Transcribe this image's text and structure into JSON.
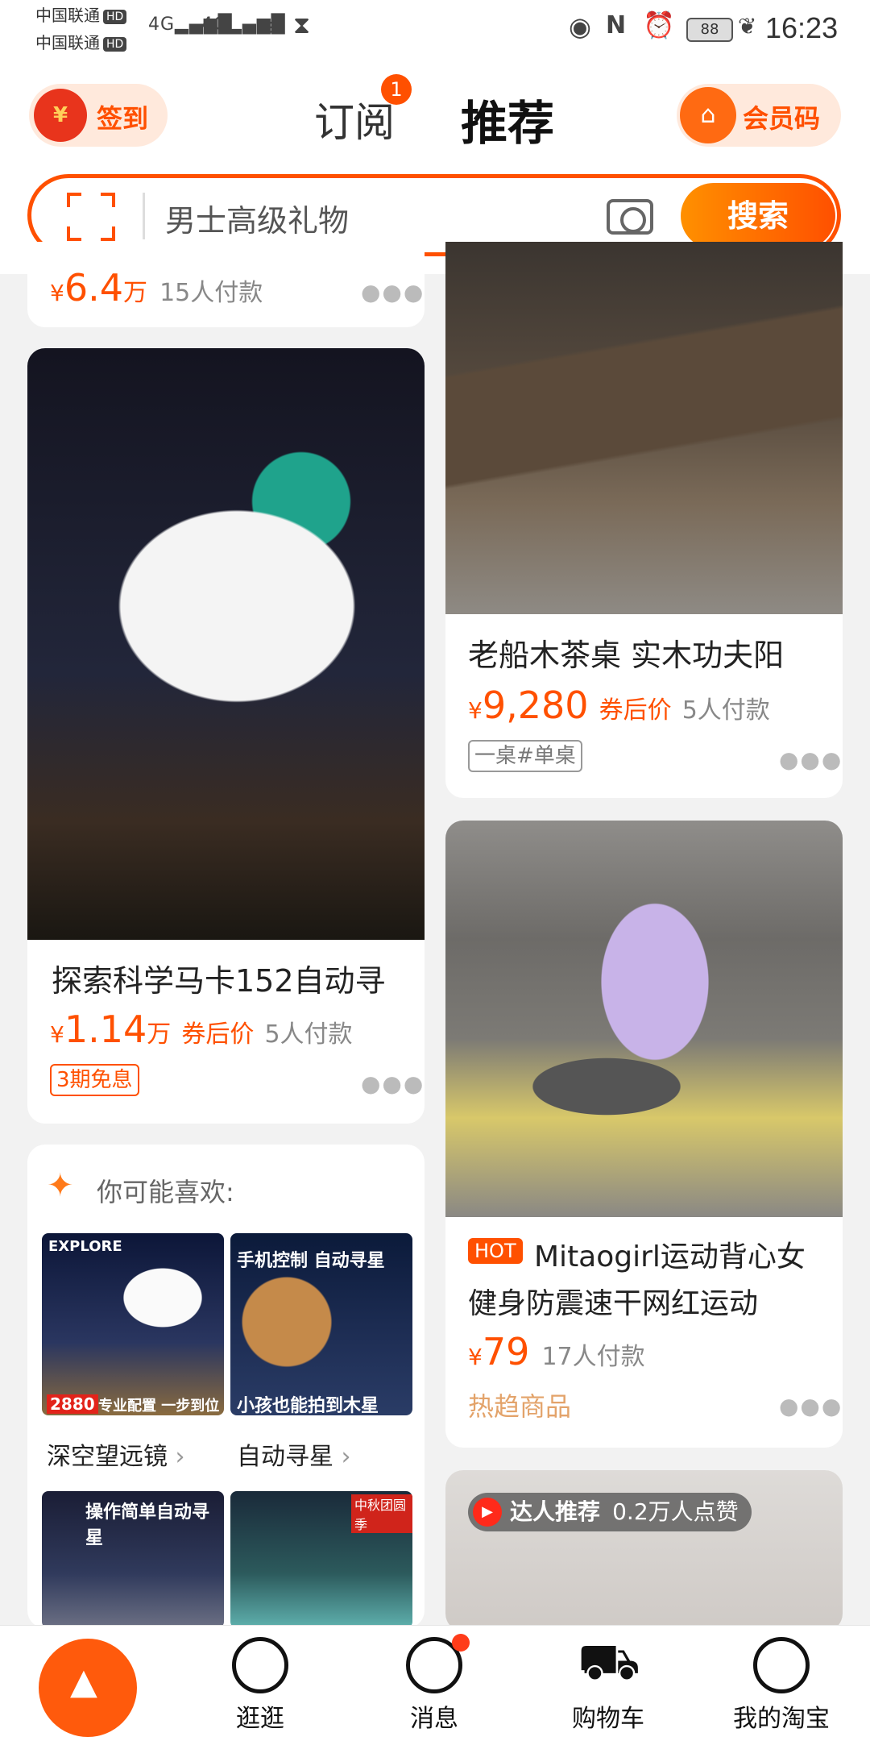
{
  "status_bar": {
    "carrier1": "中国联通",
    "carrier2": "中国联通",
    "hd_badge": "HD",
    "signal1": "4G",
    "signal2": "4G",
    "battery": "88",
    "time": "16:23"
  },
  "header": {
    "signin_label": "签到",
    "signin_icon_text": "¥",
    "tab_subscribe": "订阅",
    "tab_subscribe_badge": "1",
    "tab_recommend": "推荐",
    "member_label": "会员码"
  },
  "search": {
    "placeholder": "男士高级礼物",
    "button": "搜索"
  },
  "feed_left": {
    "top_card": {
      "price_symbol": "¥",
      "price": "6.4",
      "unit": "万",
      "paid": "15人付款"
    },
    "telescope_card": {
      "title": "探索科学马卡152自动寻",
      "price_symbol": "¥",
      "price": "1.14",
      "unit": "万",
      "coupon": "券后价",
      "paid": "5人付款",
      "tag": "3期免息"
    },
    "like_card": {
      "heading": "你可能喜欢:",
      "items": [
        {
          "caption": "",
          "category": "深空望远镜"
        },
        {
          "caption": "小孩也能拍到木星",
          "category": "自动寻星"
        }
      ],
      "mini_banner_top": "手机控制 自动寻星",
      "mini_price_tag": "2880",
      "mini_bottom_caption": "专业配置 一步到位",
      "mini3_caption": "操作简单自动寻星",
      "mini4_caption": "中秋团圆季"
    }
  },
  "feed_right": {
    "tea_card": {
      "title": "老船木茶桌 实木功夫阳",
      "price_symbol": "¥",
      "price": "9,280",
      "coupon": "券后价",
      "paid": "5人付款",
      "tag": "一桌#单桌"
    },
    "fitness_card": {
      "hot_label": "HOT",
      "title_line1": "Mitaogirl运动背心女",
      "title_line2": "健身防震速干网红运动",
      "price_symbol": "¥",
      "price": "79",
      "paid": "17人付款",
      "trend": "热趋商品"
    },
    "talent_card": {
      "label": "达人推荐",
      "likes": "0.2万人点赞"
    }
  },
  "tabbar": {
    "items": [
      {
        "label": ""
      },
      {
        "label": "逛逛"
      },
      {
        "label": "消息"
      },
      {
        "label": "购物车"
      },
      {
        "label": "我的淘宝"
      }
    ]
  },
  "colors": {
    "accent": "#ff5000",
    "accent_light": "#ffe9dc",
    "background": "#f2f2f2"
  }
}
